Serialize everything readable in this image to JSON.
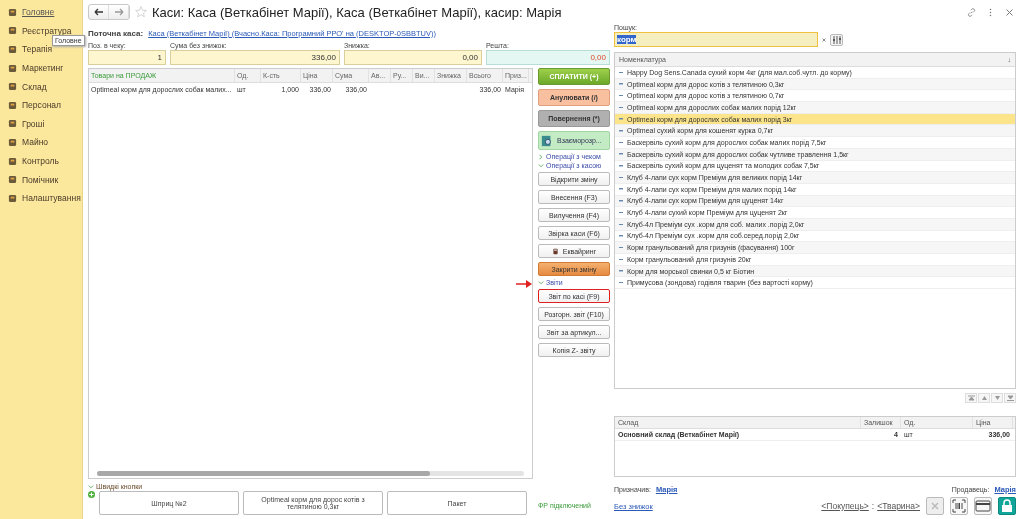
{
  "sidebar": {
    "items": [
      {
        "label": "Головне",
        "selected": true
      },
      {
        "label": "Реєстратура",
        "selected": false
      },
      {
        "label": "Терапія",
        "selected": false
      },
      {
        "label": "Маркетинг",
        "selected": false
      },
      {
        "label": "Склад",
        "selected": false
      },
      {
        "label": "Персонал",
        "selected": false
      },
      {
        "label": "Гроші",
        "selected": false
      },
      {
        "label": "Майно",
        "selected": false
      },
      {
        "label": "Контроль",
        "selected": false
      },
      {
        "label": "Помічник",
        "selected": false
      },
      {
        "label": "Налаштування",
        "selected": false
      }
    ],
    "tooltip": "Головне"
  },
  "window": {
    "title": "Каси: Каса (Веткабінет Марії), Каса (Веткабінет Марії), касир: Марія"
  },
  "current_register": {
    "label": "Поточна каса:",
    "value": "Каса (Веткабінет Марії) (Вчасно.Каса: Програмний РРО' на (DESKTOP-0SBBTUV))"
  },
  "fields": [
    {
      "label": "Поз. в чеку:",
      "value": "1",
      "kind": "plain"
    },
    {
      "label": "Сума без знижок:",
      "value": "336,00",
      "kind": "plain"
    },
    {
      "label": "Знижка:",
      "value": "0,00",
      "kind": "plain"
    },
    {
      "label": "Решта:",
      "value": "0,00",
      "kind": "change"
    }
  ],
  "table": {
    "columns": [
      "Товари на ПРОДАЖ",
      "Од.",
      "К-сть",
      "Ціна",
      "Сума",
      "Ав...",
      "Ру...",
      "Ви...",
      "Знижка",
      "Всього",
      "Приз..."
    ],
    "rows": [
      {
        "cells": [
          "Optimeal корм для дорослих собак малих...",
          "шт",
          "1,000",
          "336,00",
          "336,00"
        ],
        "end_cells": [
          "336,00",
          "Марія"
        ]
      }
    ]
  },
  "quick_buttons": {
    "title": "Швидкі кнопки",
    "expanded": true,
    "buttons": [
      "Шприц №2",
      "Optimeal корм для дорос котів з телятиною 0,3кг",
      "Пакет"
    ]
  },
  "actions": [
    {
      "kind": "pay",
      "label": "СПЛАТИТИ (+)"
    },
    {
      "kind": "cancel",
      "label": "Анулювати (/)"
    },
    {
      "kind": "return",
      "label": "Повернення (*)"
    },
    {
      "kind": "settle",
      "label": "Взаєморозр..."
    },
    {
      "kind": "section",
      "label": "Операції з чеком",
      "expanded": false
    },
    {
      "kind": "section",
      "label": "Операції з касою",
      "expanded": true
    },
    {
      "kind": "plain",
      "label": "Відкрити зміну",
      "highlighted": false
    },
    {
      "kind": "plain",
      "label": "Внесення (F3)",
      "highlighted": false
    },
    {
      "kind": "plain",
      "label": "Вилучення (F4)",
      "highlighted": false
    },
    {
      "kind": "plain",
      "label": "Звірка каси (F6)",
      "highlighted": false
    },
    {
      "kind": "acquiring",
      "label": "Еквайринг"
    },
    {
      "kind": "close",
      "label": "Закрити зміну"
    },
    {
      "kind": "section",
      "label": "Звіти",
      "expanded": true
    },
    {
      "kind": "plain",
      "label": "Звіт по касі (F9)",
      "highlighted": true
    },
    {
      "kind": "plain",
      "label": "Розгорн. звіт (F10)",
      "highlighted": false
    },
    {
      "kind": "plain",
      "label": "Звіт за артикул...",
      "highlighted": false
    },
    {
      "kind": "plain",
      "label": "Копія Z- звіту",
      "highlighted": false
    }
  ],
  "fiscal_status": "ФР підключений",
  "search": {
    "label": "Пошук:",
    "value": "корм"
  },
  "catalog": {
    "title": "Номенклатура",
    "sort": "↓",
    "items": [
      {
        "label": "Happy Dog Sens.Canada сухий корм 4кг  (для мал.соб.чутл. до корму)",
        "selected": false
      },
      {
        "label": "Optimeal корм для дорос котів з телятиною 0,3кг",
        "selected": false
      },
      {
        "label": "Optimeal корм для дорос котів з телятиною 0,7кг",
        "selected": false
      },
      {
        "label": "Optimeal корм для дорослих собак малих порід 12кг",
        "selected": false
      },
      {
        "label": "Optimeal корм для дорослих собак малих порід 3кг",
        "selected": true
      },
      {
        "label": "Optimeal сухий корм для кошенят курка 0,7кг",
        "selected": false
      },
      {
        "label": "Баскервіль сухий корм для дорослих собак малих порід 7,5кг",
        "selected": false
      },
      {
        "label": "Баскервіль сухий корм для дорослих собак чутливе травлення 1,5кг",
        "selected": false
      },
      {
        "label": "Баскервіль сухий корм для цуценят та молодих собак 7,5кг",
        "selected": false
      },
      {
        "label": "Клуб 4-лапи сух корм Преміум для великих порід 14кг",
        "selected": false
      },
      {
        "label": "Клуб 4-лапи сух корм Преміум для малих порід 14кг",
        "selected": false
      },
      {
        "label": "Клуб 4-лапи сух корм Преміум для цуценят 14кг",
        "selected": false
      },
      {
        "label": "Клуб 4-лапи сухий корм Преміум для цуценят 2кг",
        "selected": false
      },
      {
        "label": "Клуб-4л Преміум сух .корм для соб. малих .порід  2,0кг",
        "selected": false
      },
      {
        "label": "Клуб-4л Преміум сух .корм для соб.серед.порід  2,0кг",
        "selected": false
      },
      {
        "label": "Корм гранульований для гризунів (фасування) 100г",
        "selected": false
      },
      {
        "label": "Корм гранульований для гризунів 20кг",
        "selected": false
      },
      {
        "label": "Корм для морської свинки 0,5 кг Біотин",
        "selected": false
      },
      {
        "label": "Примусова (зондова) годівля тварин (без вартості корму)",
        "selected": false
      }
    ]
  },
  "stock": {
    "columns": [
      "Склад",
      "Залишок",
      "Од.",
      "Ціна"
    ],
    "rows": [
      [
        "Основний склад (Веткабінет Марії)",
        "4",
        "шт",
        "336,00"
      ]
    ]
  },
  "assigned_by": {
    "label": "Призначив:",
    "value": "Марія"
  },
  "seller": {
    "label": "Продавець:",
    "value": "Марія"
  },
  "no_discounts": "Без знижок",
  "buyer": "<Покупець>",
  "separator": ":",
  "animal": "<Тварина>"
}
